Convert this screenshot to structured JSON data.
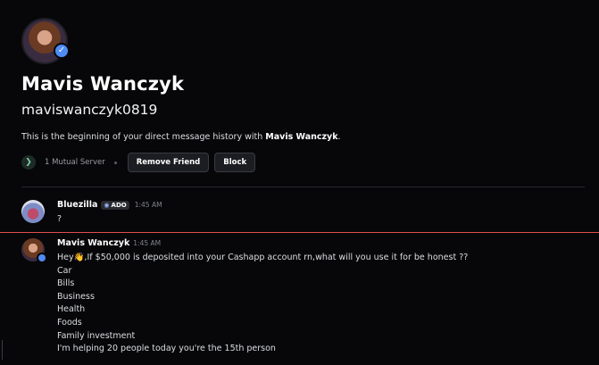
{
  "profile": {
    "display_name": "Mavis Wanczyk",
    "username": "maviswanczyk0819",
    "intro_prefix": "This is the beginning of your direct message history with ",
    "intro_name": "Mavis Wanczyk",
    "intro_suffix": "."
  },
  "actions": {
    "mutual_servers": "1 Mutual Server",
    "remove_friend": "Remove Friend",
    "block": "Block"
  },
  "messages": [
    {
      "author": "Bluezilla",
      "tag": "ADO",
      "time": "1:45 AM",
      "lines": [
        "?"
      ]
    },
    {
      "author": "Mavis Wanczyk",
      "time": "1:45 AM",
      "wave": "👋",
      "lines": [
        "Hey",
        ",If $50,000 is deposited into your Cashapp account rn,what will you use it for be honest ??",
        "Car",
        "Bills",
        "Business",
        "Health",
        "Foods",
        "Family investment",
        "I'm helping 20 people today you're the 15th person"
      ]
    }
  ],
  "colors": {
    "background": "#070709",
    "button_bg": "#1c1d22",
    "new_message_line": "#e24d4d",
    "verified": "#4f8cf7"
  },
  "icons": [
    "verified-badge-icon",
    "server-icon",
    "clan-tag-icon",
    "waving-hand-icon"
  ]
}
